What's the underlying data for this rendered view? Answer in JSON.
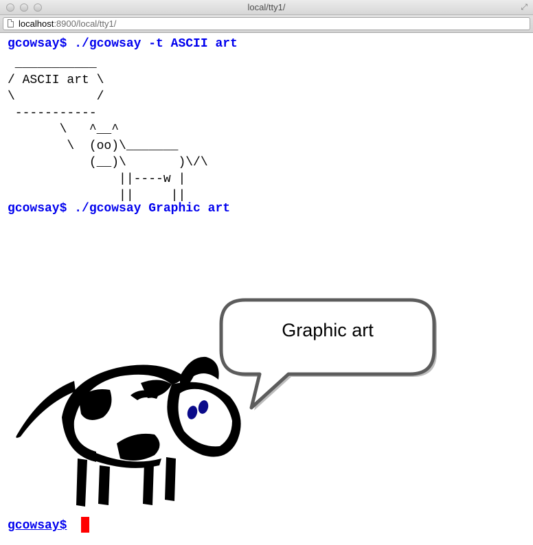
{
  "window": {
    "title": "local/tty1/"
  },
  "address_bar": {
    "url_host": "localhost",
    "url_path": ":8900/local/tty1/"
  },
  "terminal": {
    "command1": "gcowsay$ ./gcowsay -t ASCII art",
    "ascii_art": " ___________\n/ ASCII art \\\n\\           /\n -----------\n       \\   ^__^\n        \\  (oo)\\_______\n           (__)\\       )\\/\\\n               ||----w |\n               ||     ||",
    "command2": "gcowsay$ ./gcowsay Graphic art",
    "bubble_text": "Graphic art",
    "prompt": "gcowsay$"
  },
  "colors": {
    "prompt": "#0000ee",
    "cursor": "#ff0000",
    "cow_eyes": "#0a0a8a"
  }
}
